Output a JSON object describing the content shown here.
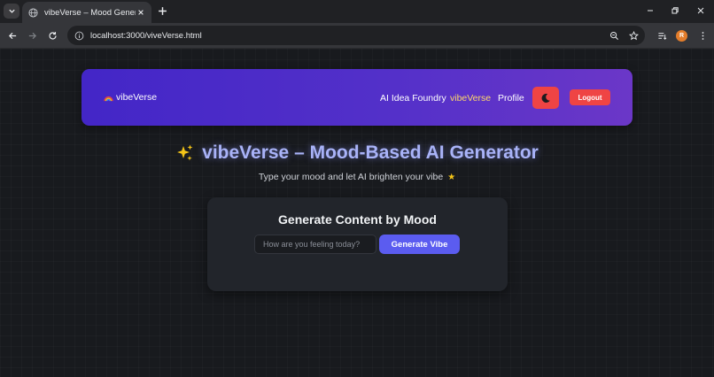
{
  "browser": {
    "tab_title": "vibeVerse – Mood Generator",
    "url": "localhost:3000/viveVerse.html",
    "profile_initial": "R"
  },
  "site": {
    "brand_name": "vibeVerse",
    "nav": {
      "idea_foundry": "AI Idea Foundry",
      "vibeverse": "vibeVerse",
      "profile": "Profile",
      "logout": "Logout"
    },
    "hero": {
      "title": "vibeVerse – Mood-Based AI Generator",
      "subtitle": "Type your mood and let AI brighten your vibe"
    },
    "card": {
      "title": "Generate Content by Mood",
      "input_placeholder": "How are you feeling today?",
      "input_value": "",
      "button_label": "Generate Vibe"
    }
  },
  "colors": {
    "nav_gradient_start": "#4326c7",
    "nav_gradient_end": "#6b37c8",
    "active_link": "#ffd86b",
    "danger": "#ef4444",
    "primary_button": "#5b5cf0",
    "hero_title": "#a9b3f8"
  },
  "icons": {
    "theme_toggle": "moon-icon",
    "brand": "rainbow-icon",
    "hero": "sparkles-icon",
    "subtitle": "star-icon"
  }
}
